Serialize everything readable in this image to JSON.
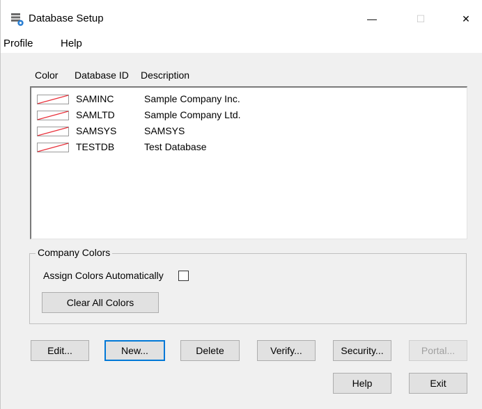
{
  "window": {
    "title": "Database Setup",
    "minimize_glyph": "—",
    "maximize_glyph": "☐",
    "close_glyph": "✕"
  },
  "menu": {
    "profile": "Profile",
    "help": "Help"
  },
  "list": {
    "headers": {
      "color": "Color",
      "database_id": "Database ID",
      "description": "Description"
    },
    "rows": [
      {
        "id": "SAMINC",
        "description": "Sample Company Inc."
      },
      {
        "id": "SAMLTD",
        "description": "Sample Company Ltd."
      },
      {
        "id": "SAMSYS",
        "description": "SAMSYS"
      },
      {
        "id": "TESTDB",
        "description": "Test Database"
      }
    ]
  },
  "company_colors": {
    "group_title": "Company Colors",
    "assign_label": "Assign Colors Automatically",
    "assign_checked": false,
    "clear_button": "Clear All Colors"
  },
  "buttons": {
    "edit": "Edit...",
    "new": "New...",
    "delete": "Delete",
    "verify": "Verify...",
    "security": "Security...",
    "portal": "Portal...",
    "help": "Help",
    "exit": "Exit"
  },
  "colors": {
    "swatch_line": "#e8303a",
    "focus_border": "#0078d7"
  }
}
